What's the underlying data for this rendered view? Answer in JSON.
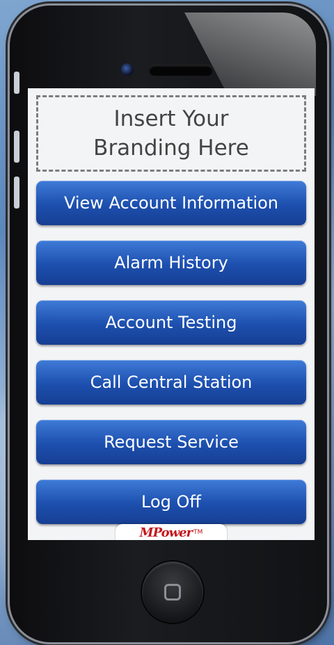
{
  "branding": {
    "line1": "Insert Your",
    "line2": "Branding Here"
  },
  "menu": [
    {
      "label": "View Account Information"
    },
    {
      "label": "Alarm History"
    },
    {
      "label": "Account Testing"
    },
    {
      "label": "Call Central Station"
    },
    {
      "label": "Request Service"
    },
    {
      "label": "Log Off"
    }
  ],
  "logo": {
    "text": "MPower",
    "suffix": "TM"
  },
  "colors": {
    "button_top": "#3f7bd8",
    "button_bottom": "#163f93",
    "logo_red": "#c4161c",
    "logo_blue": "#1c3a8c"
  },
  "icons": {
    "home": "home-square-icon",
    "camera": "camera-icon",
    "speaker": "speaker-icon"
  }
}
